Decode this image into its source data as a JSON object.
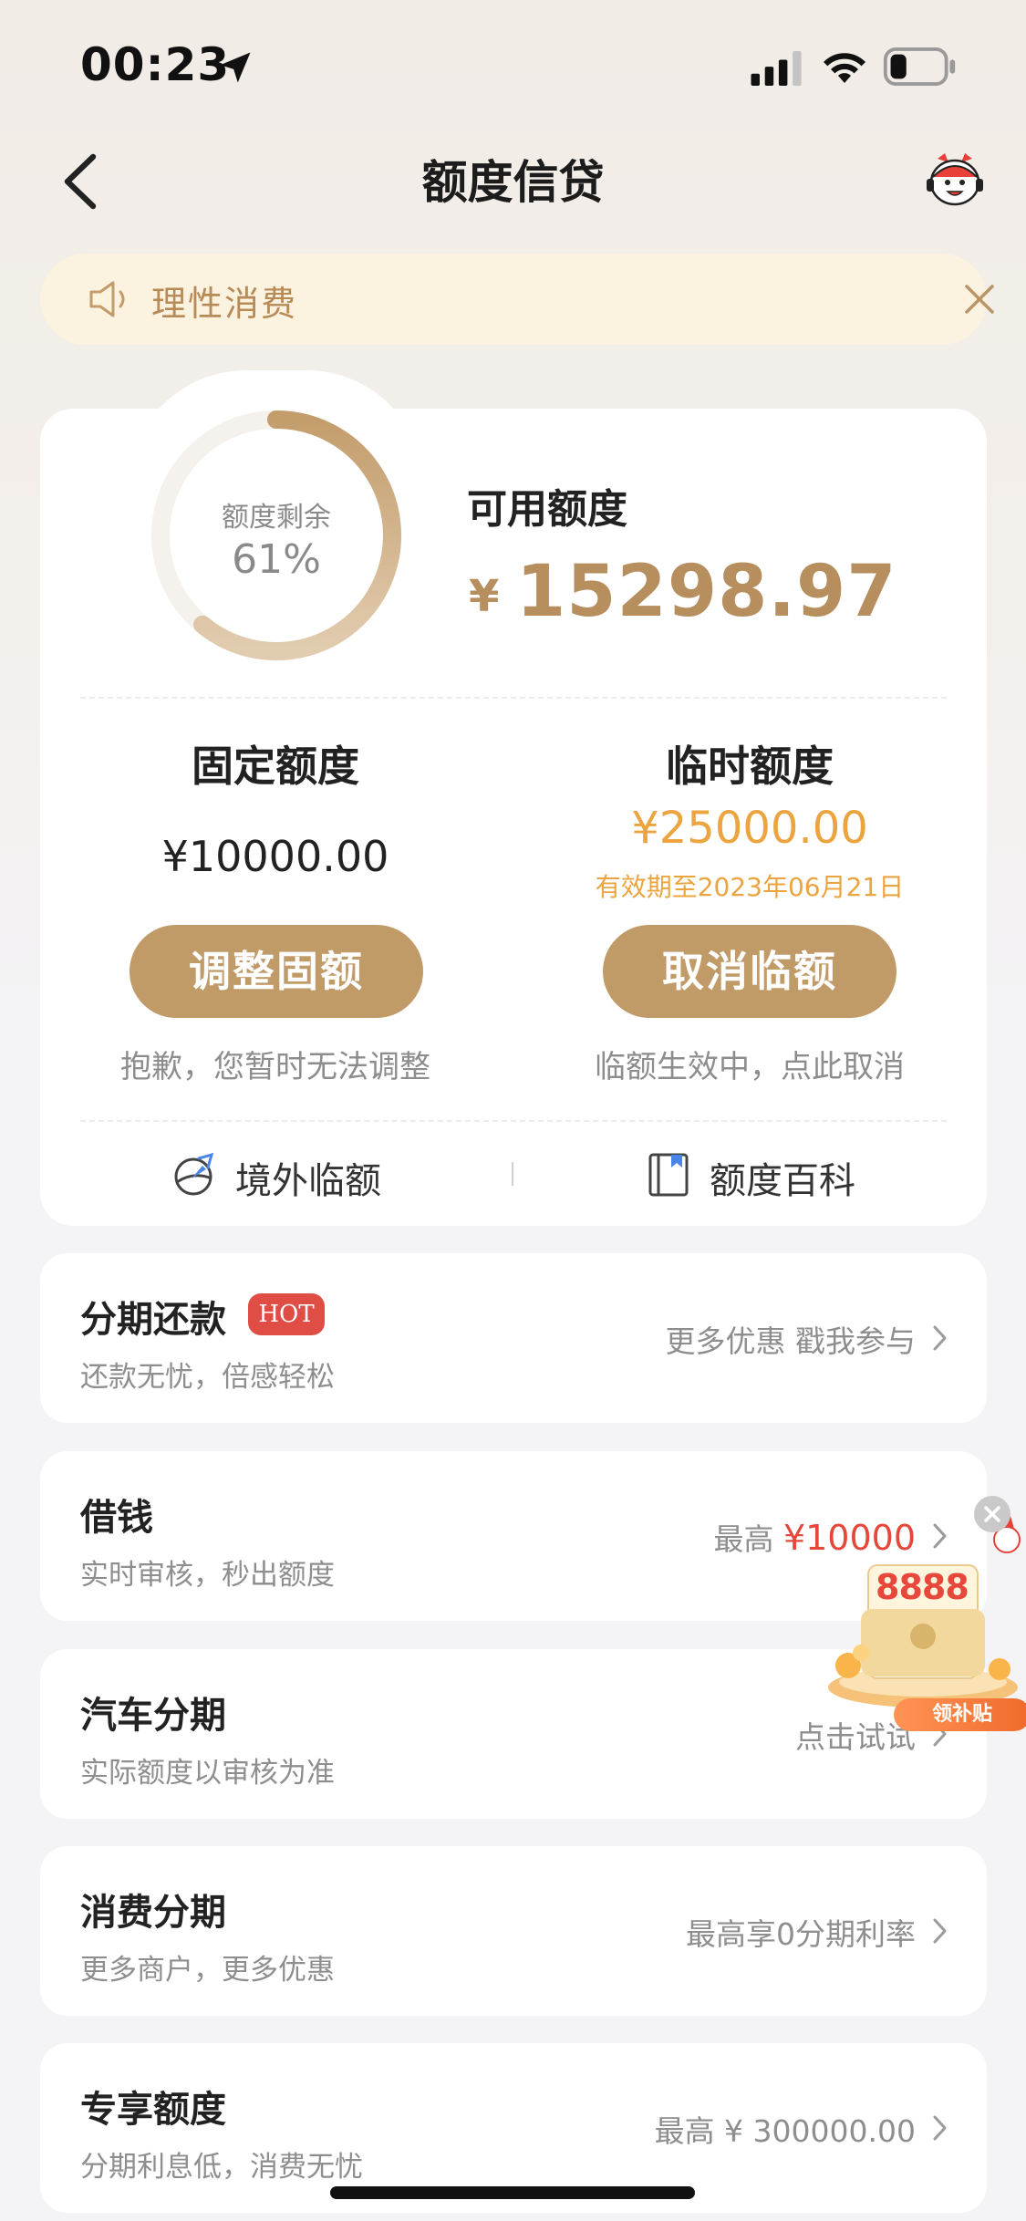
{
  "status_bar": {
    "time": "00:23"
  },
  "nav": {
    "title": "额度信贷"
  },
  "notice": {
    "text": "理性消费"
  },
  "credit": {
    "ring_label": "额度剩余",
    "remaining_percent_text": "61%",
    "remaining_fraction": 0.61,
    "available_label": "可用额度",
    "available_currency": "¥",
    "available_amount": "15298.97",
    "fixed": {
      "title": "固定额度",
      "amount": "¥10000.00",
      "button": "调整固额",
      "note": "抱歉，您暂时无法调整"
    },
    "temporary": {
      "title": "临时额度",
      "amount": "¥25000.00",
      "validity": "有效期至2023年06月21日",
      "button": "取消临额",
      "note": "临额生效中，点此取消"
    },
    "links": {
      "overseas": "境外临额",
      "wiki": "额度百科"
    }
  },
  "list": [
    {
      "title": "分期还款",
      "badge": "HOT",
      "subtitle": "还款无忧，倍感轻松",
      "right_text": "更多优惠 戳我参与"
    },
    {
      "title": "借钱",
      "subtitle": "实时审核，秒出额度",
      "right_prefix": "最高",
      "right_highlight": "¥10000"
    },
    {
      "title": "汽车分期",
      "subtitle": "实际额度以审核为准",
      "right_text": "点击试试"
    },
    {
      "title": "消费分期",
      "subtitle": "更多商户，更多优惠",
      "right_text": "最高享0分期利率"
    },
    {
      "title": "专享额度",
      "subtitle": "分期利息低，消费无忧",
      "right_text": "最高 ¥ 300000.00"
    }
  ],
  "promo": {
    "amount": "8888",
    "tag": "领补贴"
  },
  "colors": {
    "gold": "#c09a67",
    "amount_gold": "#b78e5e",
    "temp_orange": "#eba43f",
    "hot_red": "#e04d45",
    "price_red": "#e5473a"
  },
  "icons": [
    "location-arrow-icon",
    "signal-icon",
    "wifi-icon",
    "battery-icon",
    "back-chevron-icon",
    "mascot-service-icon",
    "speaker-icon",
    "close-icon",
    "globe-plane-icon",
    "book-icon",
    "chevron-right-icon"
  ]
}
